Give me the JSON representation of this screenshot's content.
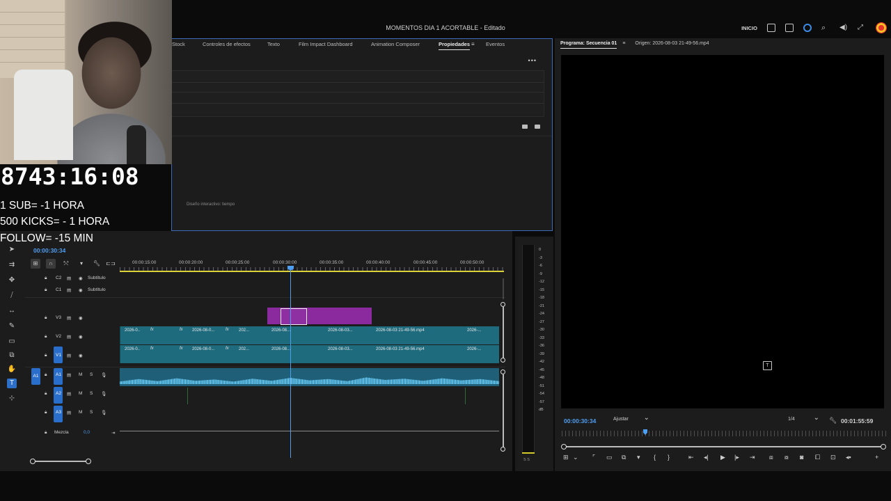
{
  "window": {
    "title": "MOMENTOS DIA 1 ACORTABLE - Editado",
    "home_label": "INICIO"
  },
  "effects_panel": {
    "tabs": [
      "Stock",
      "Controles de efectos",
      "Texto",
      "Film Impact Dashboard",
      "Animation Composer",
      "Propiedades",
      "Eventos"
    ],
    "active_tab": "Propiedades",
    "section_label": "Diseño interactivo: tiempo"
  },
  "monitor": {
    "tab_program": "Programa: Secuencia 01",
    "tab_source": "Origen: 2026-08-03 21-49-56.mp4",
    "timecode": "00:00:30:34",
    "fit": "Ajustar",
    "resolution": "1/4",
    "duration": "00:01:55:59"
  },
  "timeline": {
    "timecode": "00:00:30:34",
    "ruler_labels": [
      "00:00:15:00",
      "00:00:20:00",
      "00:00:25:00",
      "00:00:30:00",
      "00:00:35:00",
      "00:00:40:00",
      "00:00:45:00",
      "00:00:50:00"
    ],
    "tracks": {
      "c2": {
        "id": "C2",
        "name": "Subtítulo"
      },
      "c1": {
        "id": "C1",
        "name": "Subtítulo"
      },
      "v3": {
        "id": "V3"
      },
      "v2": {
        "id": "V2"
      },
      "v1": {
        "id": "V1"
      },
      "a1": {
        "id": "A1",
        "src": "A1"
      },
      "a2": {
        "id": "A2"
      },
      "a3": {
        "id": "A3"
      },
      "mix": {
        "name": "Mezcla",
        "value": "0,0"
      }
    },
    "clip_labels": {
      "short1": "2026-0..",
      "short2": "2026-08-0...",
      "short3": "202...",
      "short4": "2026-08...",
      "short5": "2026-08-03...",
      "full": "2026-08-03 21-49-56.mp4",
      "short6": "2026-..."
    },
    "fx": "fx"
  },
  "meter": {
    "scale": [
      "0",
      "-3",
      "-6",
      "-9",
      "-12",
      "-15",
      "-18",
      "-21",
      "-24",
      "-27",
      "-30",
      "-33",
      "-36",
      "-39",
      "-42",
      "-45",
      "-48",
      "-51",
      "-54",
      "-57",
      "dB"
    ],
    "solo": "S S"
  },
  "overlay": {
    "timer": "8743:16:08",
    "line1": "1 SUB= -1 HORA",
    "line2": "500 KICKS= - 1 HORA",
    "line3": "FOLLOW= -15 MIN"
  },
  "colors": {
    "accent": "#4e9ef2",
    "clip_video": "#1f6b7e",
    "clip_purple": "#8a2a9e",
    "audio": "#1f5f77"
  }
}
